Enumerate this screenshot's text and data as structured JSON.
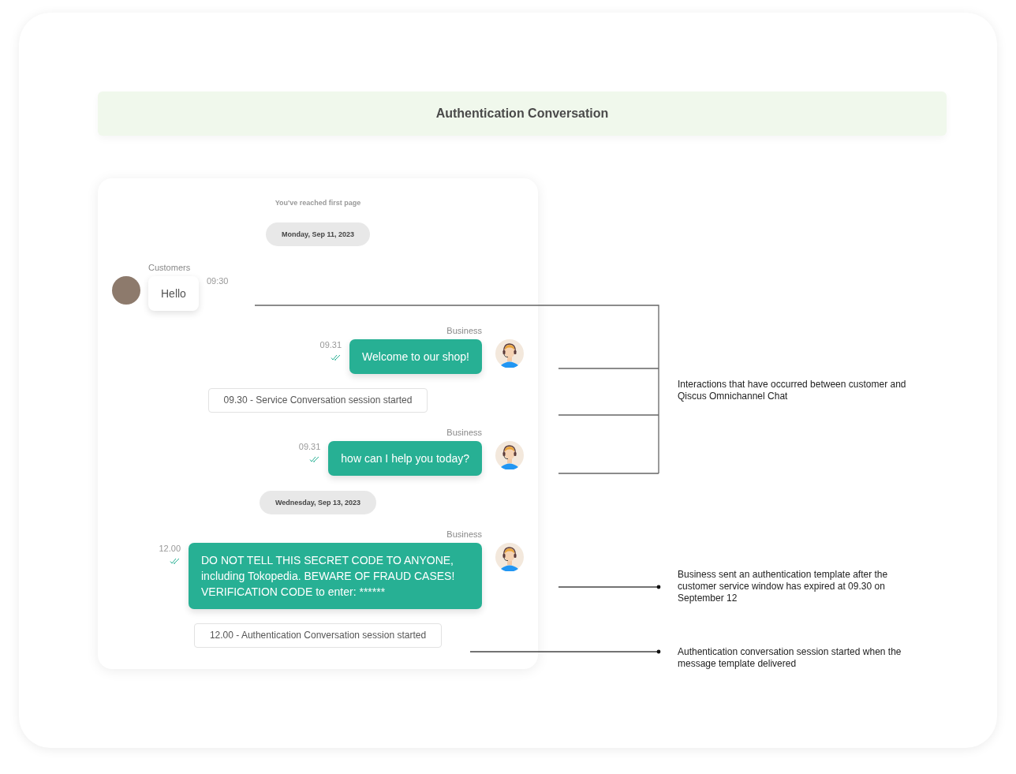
{
  "title": "Authentication Conversation",
  "chat": {
    "first_page_note": "You've reached first page",
    "items": [
      {
        "kind": "date",
        "date_label": "Monday, Sep 11, 2023"
      },
      {
        "kind": "incoming",
        "sender": "Customers",
        "text": "Hello",
        "time": "09:30"
      },
      {
        "kind": "outgoing",
        "sender": "Business",
        "text": "Welcome to our shop!",
        "time": "09.31",
        "read": true
      },
      {
        "kind": "notice",
        "text": "09.30 - Service Conversation session started"
      },
      {
        "kind": "outgoing",
        "sender": "Business",
        "text": "how can I help you today?",
        "time": "09.31",
        "read": true
      },
      {
        "kind": "date",
        "date_label": "Wednesday, Sep 13, 2023"
      },
      {
        "kind": "outgoing",
        "sender": "Business",
        "text": "DO NOT TELL THIS SECRET CODE TO ANYONE, including Tokopedia. BEWARE OF FRAUD CASES! VERIFICATION CODE to enter: ******",
        "time": "12.00",
        "read": true
      },
      {
        "kind": "notice",
        "text": "12.00 - Authentication Conversation session started"
      }
    ]
  },
  "annotations": [
    {
      "text": "Interactions that have occurred between customer and Qiscus Omnichannel Chat"
    },
    {
      "text": "Business sent an authentication template after the customer service window has expired at 09.30 on September 12"
    },
    {
      "text": "Authentication conversation session started when the message template delivered"
    }
  ]
}
